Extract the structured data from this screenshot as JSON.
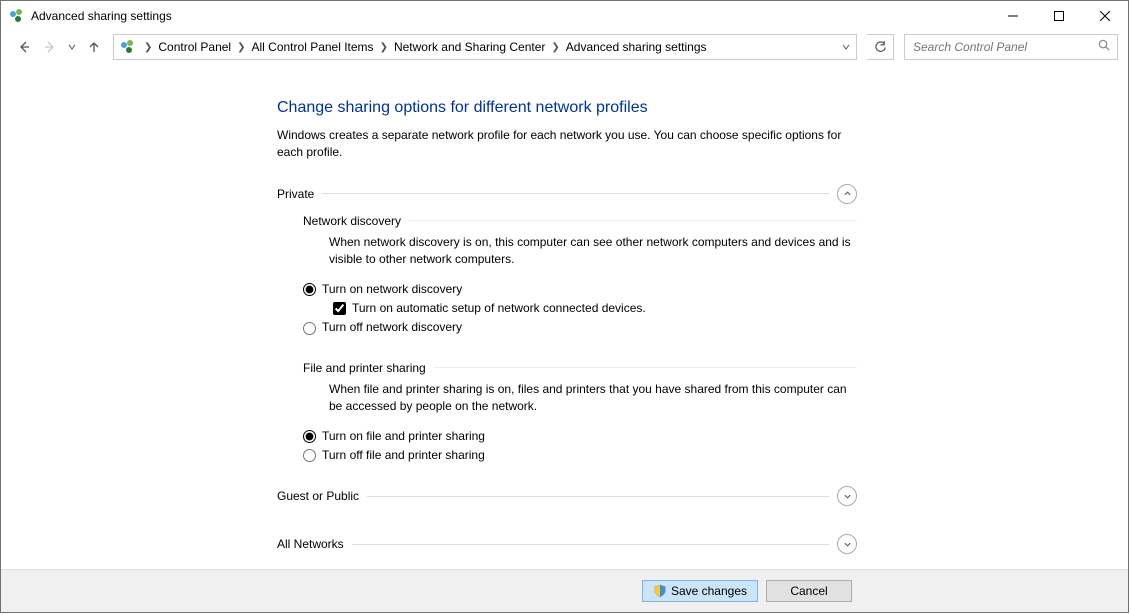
{
  "window": {
    "title": "Advanced sharing settings"
  },
  "breadcrumbs": {
    "b0": "Control Panel",
    "b1": "All Control Panel Items",
    "b2": "Network and Sharing Center",
    "b3": "Advanced sharing settings"
  },
  "search": {
    "placeholder": "Search Control Panel"
  },
  "page": {
    "title": "Change sharing options for different network profiles",
    "desc": "Windows creates a separate network profile for each network you use. You can choose specific options for each profile."
  },
  "sections": {
    "private": {
      "label": "Private",
      "net_discovery": {
        "label": "Network discovery",
        "desc": "When network discovery is on, this computer can see other network computers and devices and is visible to other network computers.",
        "opt_on": "Turn on network discovery",
        "opt_auto": "Turn on automatic setup of network connected devices.",
        "opt_off": "Turn off network discovery"
      },
      "file_printer": {
        "label": "File and printer sharing",
        "desc": "When file and printer sharing is on, files and printers that you have shared from this computer can be accessed by people on the network.",
        "opt_on": "Turn on file and printer sharing",
        "opt_off": "Turn off file and printer sharing"
      }
    },
    "guest": {
      "label": "Guest or Public"
    },
    "all": {
      "label": "All Networks"
    }
  },
  "footer": {
    "save": "Save changes",
    "cancel": "Cancel"
  }
}
